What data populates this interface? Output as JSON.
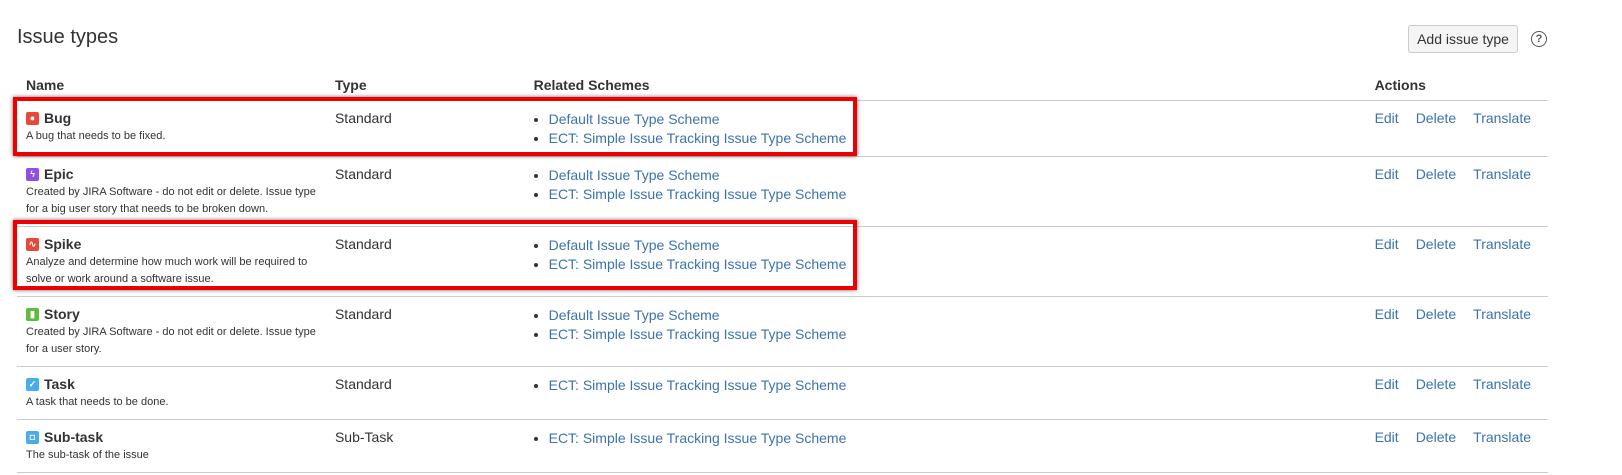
{
  "title": "Issue types",
  "add_button": "Add issue type",
  "help_icon": "?",
  "columns": [
    "Name",
    "Type",
    "Related Schemes",
    "Actions"
  ],
  "actions": [
    "Edit",
    "Delete",
    "Translate"
  ],
  "rows": [
    {
      "name": "Bug",
      "icon": "bug-icon",
      "color": "#e5493a",
      "glyph": "●",
      "desc": "A bug that needs to be fixed.",
      "type": "Standard",
      "schemes": [
        "Default Issue Type Scheme",
        "ECT: Simple Issue Tracking Issue Type Scheme"
      ]
    },
    {
      "name": "Epic",
      "icon": "epic-icon",
      "color": "#904ee2",
      "glyph": "ϟ",
      "desc": "Created by JIRA Software - do not edit or delete. Issue type for a big user story that needs to be broken down.",
      "type": "Standard",
      "schemes": [
        "Default Issue Type Scheme",
        "ECT: Simple Issue Tracking Issue Type Scheme"
      ]
    },
    {
      "name": "Spike",
      "icon": "spike-icon",
      "color": "#e5493a",
      "glyph": "∿",
      "desc": "Analyze and determine how much work will be required to solve or work around a software issue.",
      "type": "Standard",
      "schemes": [
        "Default Issue Type Scheme",
        "ECT: Simple Issue Tracking Issue Type Scheme"
      ]
    },
    {
      "name": "Story",
      "icon": "story-icon",
      "color": "#63ba3c",
      "glyph": "▮",
      "desc": "Created by JIRA Software - do not edit or delete. Issue type for a user story.",
      "type": "Standard",
      "schemes": [
        "Default Issue Type Scheme",
        "ECT: Simple Issue Tracking Issue Type Scheme"
      ]
    },
    {
      "name": "Task",
      "icon": "task-icon",
      "color": "#4bade8",
      "glyph": "✓",
      "desc": "A task that needs to be done.",
      "type": "Standard",
      "schemes": [
        "ECT: Simple Issue Tracking Issue Type Scheme"
      ]
    },
    {
      "name": "Sub-task",
      "icon": "subtask-icon",
      "color": "#4bade8",
      "glyph": "◘",
      "desc": "The sub-task of the issue",
      "type": "Sub-Task",
      "schemes": [
        "ECT: Simple Issue Tracking Issue Type Scheme"
      ]
    }
  ]
}
